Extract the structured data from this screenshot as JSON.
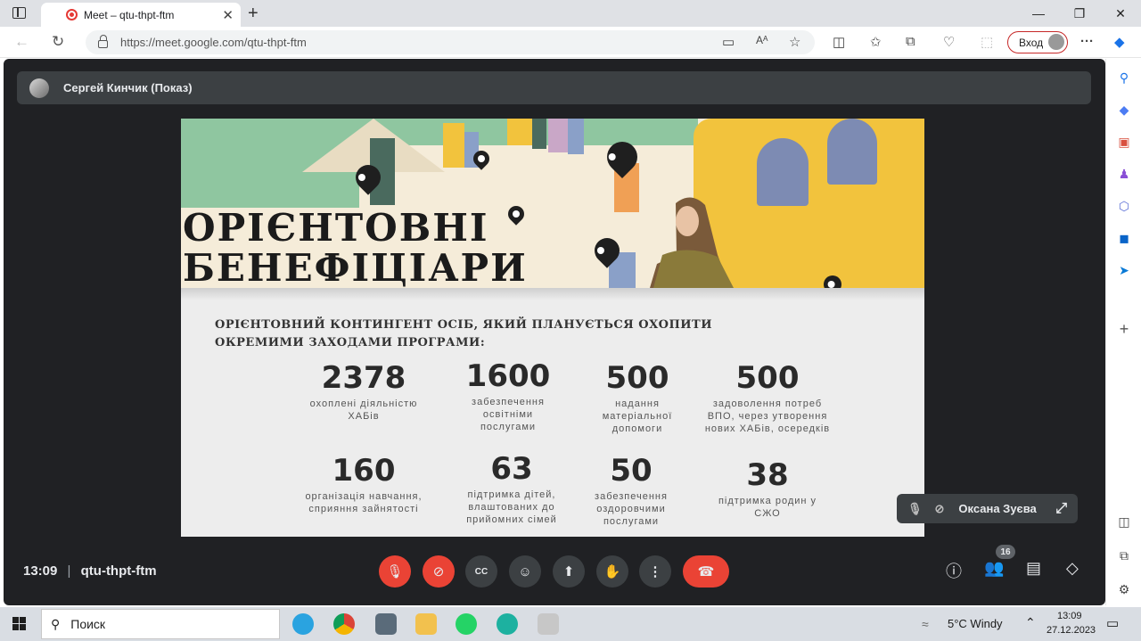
{
  "browser": {
    "tab_title": "Meet – qtu-thpt-ftm",
    "url": "https://meet.google.com/qtu-thpt-ftm",
    "signin_label": "Вход"
  },
  "meet": {
    "presenter_label": "Сергей Кинчик (Показ)",
    "time": "13:09",
    "meeting_code": "qtu-thpt-ftm",
    "participants_count": "16",
    "self_name": "Оксана Зуєва"
  },
  "slide": {
    "headline_line1": "ОРІЄНТОВНІ",
    "headline_line2": "БЕНЕФІЦІАРИ",
    "subtitle": "ОРІЄНТОВНИЙ КОНТИНГЕНТ ОСІБ, ЯКИЙ ПЛАНУЄТЬСЯ ОХОПИТИ ОКРЕМИМИ ЗАХОДАМИ ПРОГРАМИ:",
    "stats": [
      {
        "num": "2378",
        "label": "охоплені діяльністю ХАБів"
      },
      {
        "num": "1600",
        "label": "забезпечення освітніми послугами"
      },
      {
        "num": "500",
        "label": "надання матеріальної допомоги"
      },
      {
        "num": "500",
        "label": "задоволення потреб ВПО, через утворення нових ХАБів, осередків"
      },
      {
        "num": "160",
        "label": "організація навчання, сприяння зайнятості"
      },
      {
        "num": "63",
        "label": "підтримка дітей, влаштованих до прийомних сімей"
      },
      {
        "num": "50",
        "label": "забезпечення оздоровчими послугами"
      },
      {
        "num": "38",
        "label": "підтримка родин у СЖО"
      }
    ]
  },
  "taskbar": {
    "search_placeholder": "Поиск",
    "weather": "5°C  Windy",
    "time": "13:09",
    "date": "27.12.2023"
  }
}
